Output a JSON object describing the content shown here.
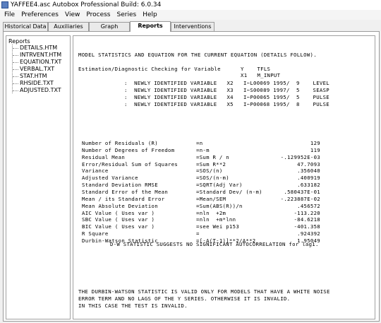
{
  "window": {
    "title": "YAFFEE4.asc  Autobox Professional Build: 6.0.34"
  },
  "menu": [
    "File",
    "Preferences",
    "View",
    "Process",
    "Series",
    "Help"
  ],
  "tabs": [
    "Historical Data",
    "Auxiliaries",
    "Graph",
    "Reports",
    "Interventions"
  ],
  "active_tab": "Reports",
  "tree": {
    "root": "Reports",
    "items": [
      "DETAILS.HTM",
      "INTRVENT.HTM",
      "EQUATION.TXT",
      "VERBAL.TXT",
      "STAT.HTM",
      "RHSIDE.TXT",
      "ADJUSTED.TXT"
    ]
  },
  "report": {
    "heading": "MODEL STATISTICS AND EQUATION FOR THE CURRENT EQUATION (DETAILS FOLLOW).",
    "estimation_left": "Estimation/Diagnostic Checking for Variable",
    "estimation_right": "Y    TFLS",
    "x1_line": "X1   M_INPUT",
    "variables": [
      ":  NEWLY IDENTIFIED VARIABLE   X2   I~L00069 1995/  9    LEVEL",
      ":  NEWLY IDENTIFIED VARIABLE   X3   I~S00089 1997/  5    SEASP",
      ":  NEWLY IDENTIFIED VARIABLE   X4   I~P00065 1995/  5    PULSE",
      ":  NEWLY IDENTIFIED VARIABLE   X5   I~P00068 1995/  8    PULSE"
    ],
    "stats": [
      {
        "name": "Number of Residuals (R)",
        "formula": "=n",
        "value": "129"
      },
      {
        "name": "Number of Degrees of Freedom",
        "formula": "=n-m",
        "value": "119"
      },
      {
        "name": "Residual Mean",
        "formula": "=Sum R / n",
        "value": "-.129952E-03"
      },
      {
        "name": "Error/Residual Sum of Squares",
        "formula": "=Sum R**2",
        "value": "47.7093"
      },
      {
        "name": "Variance",
        "formula": "=SOS/(n)",
        "value": ".356040"
      },
      {
        "name": "Adjusted Variance",
        "formula": "=SOS/(n-m)",
        "value": ".400919"
      },
      {
        "name": "Standard Deviation RMSE",
        "formula": "=SQRT(Adj Var)",
        "value": ".633182"
      },
      {
        "name": "Standard Error of the Mean",
        "formula": "=Standard Dev/ (n-m)",
        "value": ".580437E-01"
      },
      {
        "name": "Mean / its Standard Error",
        "formula": "=Mean/SEM",
        "value": "-.223887E-02"
      },
      {
        "name": "Mean Absolute Deviation",
        "formula": "=Sum(ABS(R))/n",
        "value": ".456572"
      },
      {
        "name": "AIC Value ( Uses var )",
        "formula": "=nln  +2m",
        "value": "-113.220"
      },
      {
        "name": "SBC Value ( Uses var )",
        "formula": "=nln  +m*lnn",
        "value": "-84.6218"
      },
      {
        "name": "BIC Value ( Uses var )",
        "formula": "=see Wei p153",
        "value": "-401.358"
      },
      {
        "name": "R Square",
        "formula": "=",
        "value": ".924392"
      },
      {
        "name": "Durbin-Watson Statistic",
        "formula": "=[-A(T-1)]**2/A**2",
        "value": "1.95049"
      }
    ],
    "dw_note": "D-W STATISTIC SUGGESTS NO SIGNIFICANT AUTOCORRELATION for lag1.",
    "footer": [
      "THE DURBIN-WATSON STATISTIC IS VALID ONLY FOR MODELS THAT HAVE A WHITE NOISE",
      "ERROR TERM AND NO LAGS OF THE Y SERIES. OTHERWISE IT IS INVALID.",
      "IN THIS CASE THE TEST IS INVALID."
    ]
  }
}
